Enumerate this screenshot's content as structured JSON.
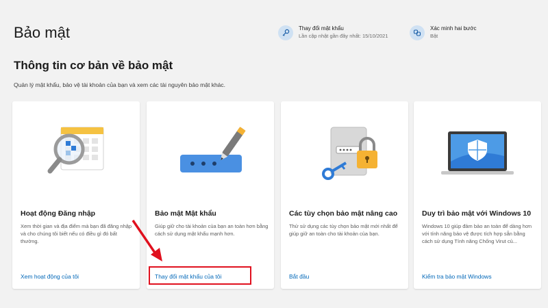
{
  "page": {
    "title": "Bảo mật"
  },
  "header_actions": {
    "password": {
      "label": "Thay đổi mật khẩu",
      "sub": "Lần cập nhật gần đây nhất: 15/10/2021",
      "icon": "key-icon"
    },
    "two_step": {
      "label": "Xác minh hai bước",
      "sub": "Bật",
      "icon": "link-icon"
    }
  },
  "section": {
    "title": "Thông tin cơ bản về bảo mật",
    "description": "Quản lý mật khẩu, bảo vệ tài khoản của bạn và xem các tài nguyên bảo mật khác."
  },
  "cards": [
    {
      "title": "Hoạt động Đăng nhập",
      "description": "Xem thời gian và địa điểm mà bạn đã đăng nhập và cho chúng tôi biết nếu có điều gì đó bất thường.",
      "link": "Xem hoạt động của tôi",
      "icon": "calendar-magnifier-icon"
    },
    {
      "title": "Bảo mật Mật khẩu",
      "description": "Giúp giữ cho tài khoản của bạn an toàn hơn bằng cách sử dụng mật khẩu mạnh hơn.",
      "link": "Thay đổi mật khẩu của tôi",
      "icon": "password-pen-icon"
    },
    {
      "title": "Các tùy chọn bảo mật nâng cao",
      "description": "Thử sử dụng các tùy chọn bảo mật mới nhất để giúp giữ an toàn cho tài khoản của bạn.",
      "link": "Bắt đầu",
      "icon": "key-lock-icon"
    },
    {
      "title": "Duy trì bảo mật với Windows 10",
      "description": "Windows 10 giúp đảm bảo an toàn để dàng hơn với tính năng bảo vệ được tích hợp sẵn bằng cách sử dụng Tính năng Chống Virut củ...",
      "link": "Kiểm tra bảo mật Windows",
      "icon": "laptop-shield-icon"
    }
  ],
  "colors": {
    "link": "#0067b8",
    "highlight": "#e0101e",
    "background": "#f2f2f2"
  }
}
